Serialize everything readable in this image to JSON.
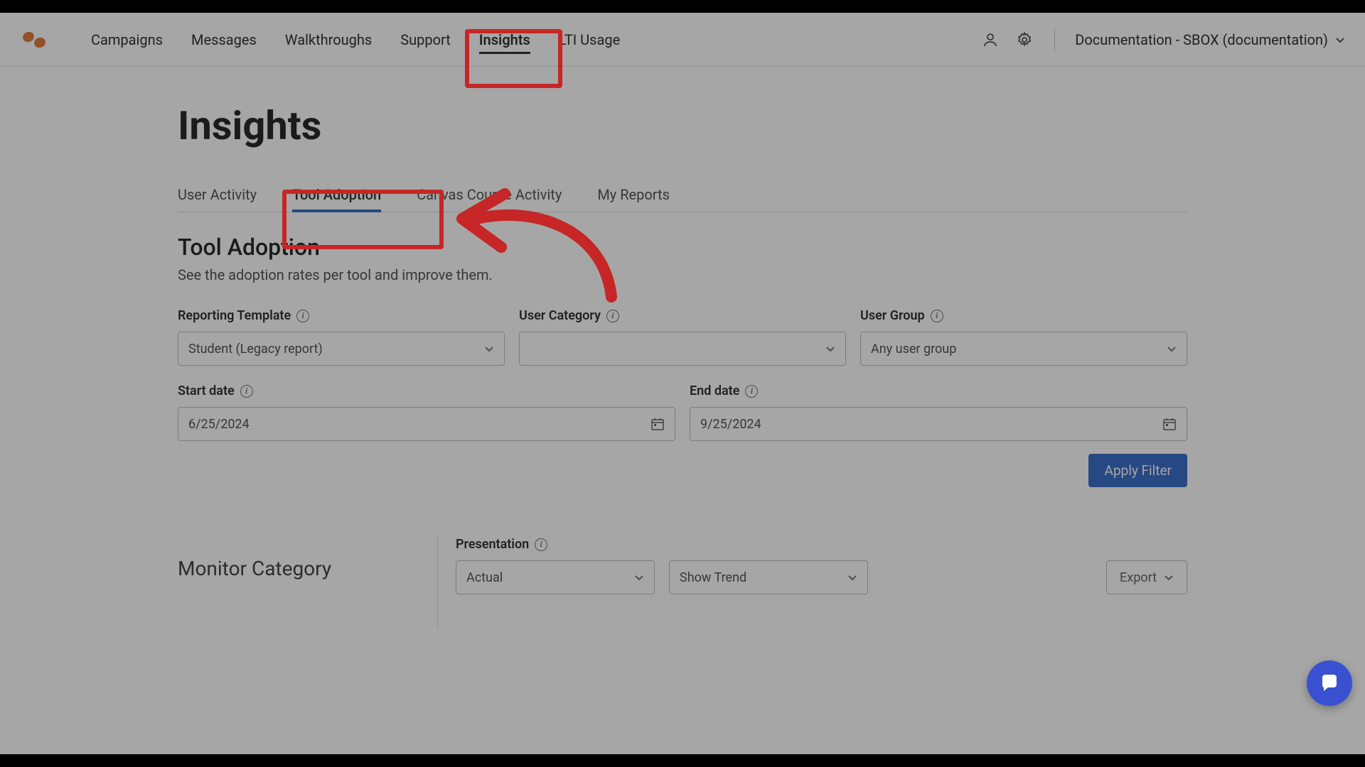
{
  "nav": {
    "items": [
      "Campaigns",
      "Messages",
      "Walkthroughs",
      "Support",
      "Insights",
      "LTI Usage"
    ],
    "activeIndex": 4
  },
  "account": {
    "label": "Documentation - SBOX (documentation)"
  },
  "page": {
    "title": "Insights"
  },
  "tabs": {
    "items": [
      "User Activity",
      "Tool Adoption",
      "Canvas Course Activity",
      "My Reports"
    ],
    "activeIndex": 1
  },
  "section": {
    "title": "Tool Adoption",
    "description": "See the adoption rates per tool and improve them."
  },
  "filters": {
    "reporting_template": {
      "label": "Reporting Template",
      "value": "Student (Legacy report)"
    },
    "user_category": {
      "label": "User Category",
      "value": ""
    },
    "user_group": {
      "label": "User Group",
      "value": "Any user group"
    },
    "start_date": {
      "label": "Start date",
      "value": "6/25/2024"
    },
    "end_date": {
      "label": "End date",
      "value": "9/25/2024"
    },
    "apply_label": "Apply Filter"
  },
  "lower": {
    "monitor_title": "Monitor Category",
    "presentation_label": "Presentation",
    "actual": "Actual",
    "show_trend": "Show Trend",
    "export_label": "Export"
  }
}
